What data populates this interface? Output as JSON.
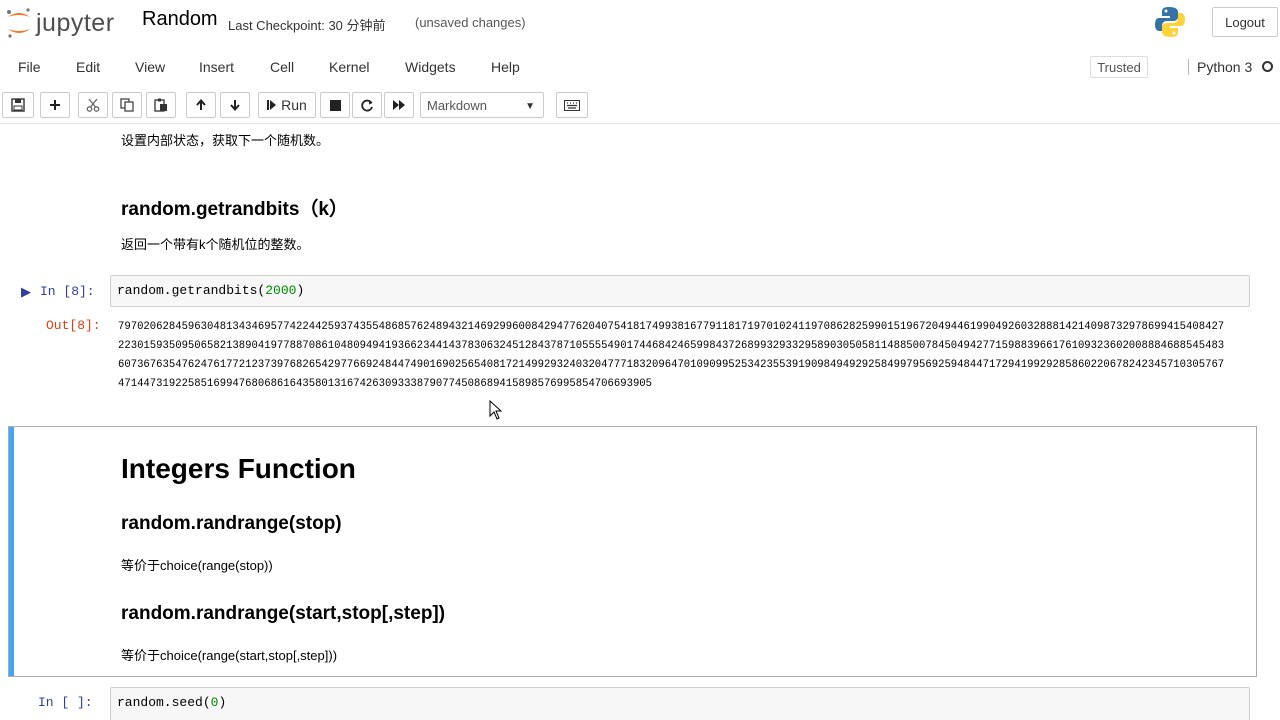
{
  "header": {
    "logo_text": "jupyter",
    "notebook_title": "Random",
    "checkpoint": "Last Checkpoint: 30 分钟前",
    "unsaved": "(unsaved changes)",
    "logout_label": "Logout"
  },
  "menubar": {
    "items": [
      "File",
      "Edit",
      "View",
      "Insert",
      "Cell",
      "Kernel",
      "Widgets",
      "Help"
    ],
    "trusted_label": "Trusted",
    "kernel_name": "Python 3"
  },
  "toolbar": {
    "run_label": "Run",
    "cell_type": "Markdown"
  },
  "cells": {
    "intro_text": "设置内部状态，获取下一个随机数。",
    "getrandbits_heading": "random.getrandbits（k）",
    "getrandbits_desc": "返回一个带有k个随机位的整数。",
    "code1_prompt": "In [8]:",
    "code1_func": "random.getrandbits(",
    "code1_arg": "2000",
    "code1_close": ")",
    "out1_prompt": "Out[8]:",
    "out1_value": "797020628459630481343469577422442593743554868576248943214692996008429477620407541817499381677911817197010241197086282599015196720494461990492603288814214098732978699415408427223015935095065821389041977887086104809494193662344143783063245128437871055554901744684246599843726899329332958903050581148850078450494277159883966176109323602008884688545483607367635476247617721237397682654297766924844749016902565408172149929324032047771832096470109099525342355391909849492925849979569259484471729419929285860220678242345710305767471447319225851699476806861643580131674263093338790774508689415898576995854706693905",
    "integers_heading": "Integers Function",
    "randrange_heading": "random.randrange(stop)",
    "randrange_desc": "等价于choice(range(stop))",
    "randrange2_heading": "random.randrange(start,stop[,step])",
    "randrange2_desc": "等价于choice(range(start,stop[,step]))",
    "code2_prompt": "In [ ]:",
    "code2_func": "random.seed(",
    "code2_arg": "0",
    "code2_close": ")"
  },
  "colors": {
    "accent_blue": "#42a5f5",
    "prompt_in": "#303f9f",
    "prompt_out": "#d84315"
  }
}
